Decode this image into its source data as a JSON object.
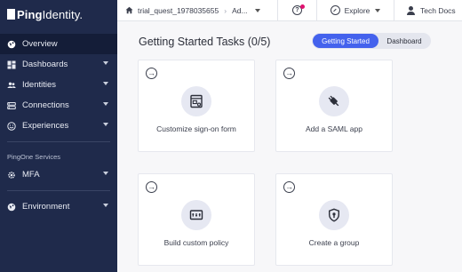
{
  "brand": {
    "name_bold": "Ping",
    "name_regular": "Identity."
  },
  "topbar": {
    "env_name": "trial_quest_1978035655",
    "env_sub": "Ad...",
    "explore_label": "Explore",
    "docs_label": "Tech Docs"
  },
  "sidebar": {
    "items": [
      {
        "label": "Overview",
        "icon": "globe-icon",
        "active": true
      },
      {
        "label": "Dashboards",
        "icon": "dashboard-icon"
      },
      {
        "label": "Identities",
        "icon": "users-icon"
      },
      {
        "label": "Connections",
        "icon": "connections-icon"
      },
      {
        "label": "Experiences",
        "icon": "smiley-icon"
      }
    ],
    "group_label": "PingOne Services",
    "services": [
      {
        "label": "MFA",
        "icon": "gear-icon"
      }
    ],
    "bottom": [
      {
        "label": "Environment",
        "icon": "globe-icon"
      }
    ]
  },
  "main": {
    "title": "Getting Started Tasks (0/5)",
    "toggle": {
      "active": "Getting Started",
      "inactive": "Dashboard"
    },
    "cards": [
      {
        "label": "Customize sign-on form",
        "icon": "form-icon"
      },
      {
        "label": "Add a SAML app",
        "icon": "plug-icon"
      },
      {
        "label": "Build custom policy",
        "icon": "policy-icon"
      },
      {
        "label": "Create a group",
        "icon": "shield-lock-icon"
      }
    ]
  },
  "colors": {
    "sidebar": "#1f2a4b",
    "accent": "#4462ed",
    "notification": "#e0116f"
  }
}
